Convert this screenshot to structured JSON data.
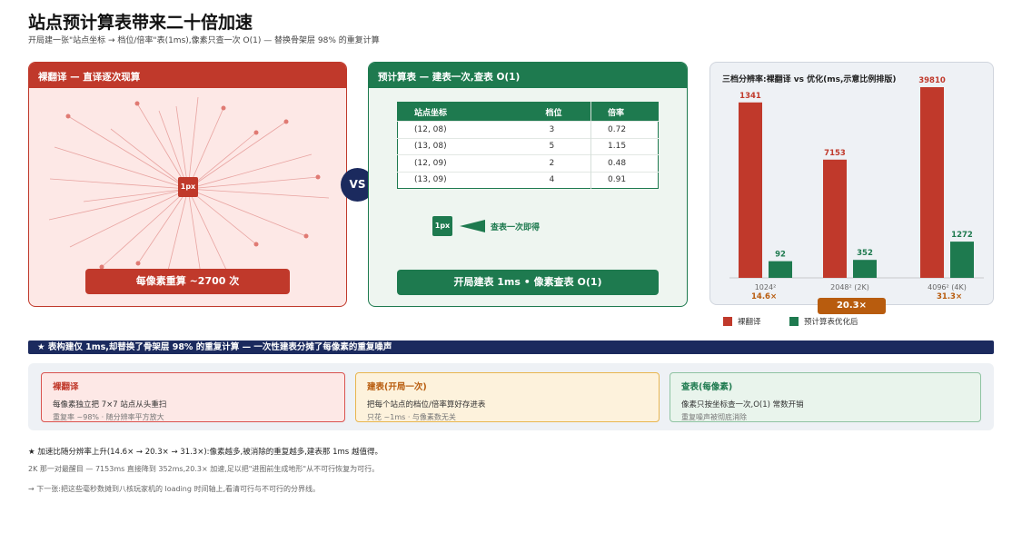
{
  "header": {
    "title": "站点预计算表带来二十倍加速",
    "subtitle": "开局建一张\"站点坐标 → 档位/倍率\"表(1ms),像素只查一次 O(1) — 替换骨架层 98% 的重复计算"
  },
  "colors": {
    "red": "#c0392b",
    "green": "#1e7a4f",
    "navy": "#1b2a5e",
    "orange": "#b85c0e"
  },
  "left_panel": {
    "title": "裸翻译 — 直译逐次现算",
    "center_chip": "1px",
    "footer": "每像素重算 ~2700 次"
  },
  "vs_label": "VS",
  "mid_panel": {
    "title": "预计算表 — 建表一次,查表 O(1)",
    "table": {
      "headers": [
        "站点坐标",
        "档位",
        "倍率"
      ],
      "rows": [
        [
          "(12, 08)",
          "3",
          "0.72"
        ],
        [
          "(13, 08)",
          "5",
          "1.15"
        ],
        [
          "(12, 09)",
          "2",
          "0.48"
        ],
        [
          "(13, 09)",
          "4",
          "0.91"
        ]
      ]
    },
    "chip": "1px",
    "lookup_label": "查表一次即得",
    "footer": "开局建表 1ms • 像素查表 O(1)"
  },
  "chart_panel": {
    "speedups": [
      "14.6×",
      "20.3×",
      "31.3×"
    ],
    "legend": [
      "裸翻译",
      "预计算表优化后"
    ]
  },
  "chart_data": {
    "type": "bar",
    "title": "三档分辨率:裸翻译 vs 优化(ms,示意比例排版)",
    "categories": [
      "1024²",
      "2048² (2K)",
      "4096² (4K)"
    ],
    "series": [
      {
        "name": "裸翻译",
        "values": [
          1341,
          7153,
          39810
        ],
        "color": "#c0392b"
      },
      {
        "name": "预计算表优化后",
        "values": [
          92,
          352,
          1272
        ],
        "color": "#1e7a4f"
      }
    ],
    "bar_scale": [
      0.195,
      0.315,
      0.615
    ],
    "baseline_scale": [
      0.92,
      0.62,
      1.0
    ]
  },
  "banner": "★ 表构建仅 1ms,却替换了骨架层 98% 的重复计算 — 一次性建表分摊了每像素的重复噪声",
  "cards": [
    {
      "title": "裸翻译",
      "line1": "每像素独立把 7×7 站点从头重扫",
      "line2": "重复率 ~98% · 随分辨率平方放大"
    },
    {
      "title": "建表(开局一次)",
      "line1": "把每个站点的档位/倍率算好存进表",
      "line2": "只花 ~1ms · 与像素数无关"
    },
    {
      "title": "查表(每像素)",
      "line1": "像素只按坐标查一次,O(1) 常数开销",
      "line2": "重复噪声被彻底消除"
    }
  ],
  "notes": [
    "★ 加速比随分辨率上升(14.6× → 20.3× → 31.3×):像素越多,被消除的重复越多,建表那 1ms 越值得。",
    "2K 那一对最醒目 — 7153ms 直接降到 352ms,20.3× 加速,足以把\"进图前生成地形\"从不可行恢复为可行。",
    "→ 下一张:把这些毫秒数摊到八核玩家机的 loading 时间轴上,看清可行与不可行的分界线。"
  ]
}
